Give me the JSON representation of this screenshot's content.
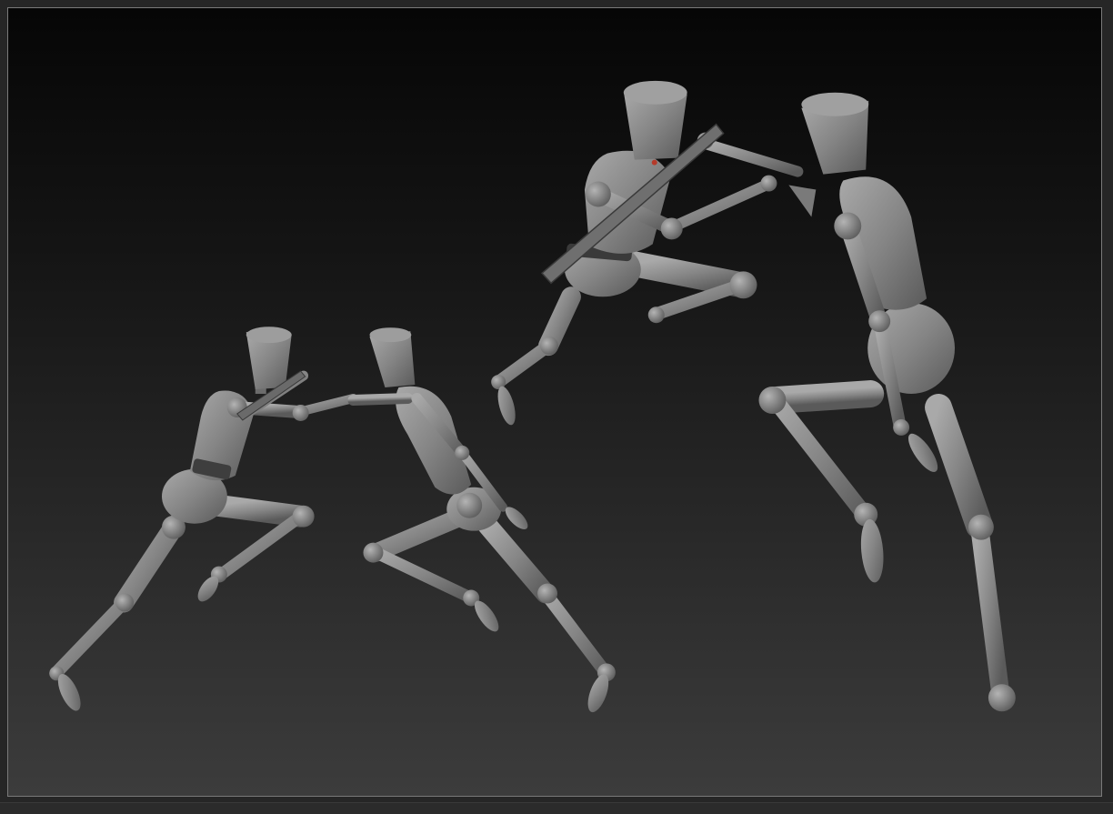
{
  "viewport": {
    "title": "",
    "background_top": "#060606",
    "background_bottom": "#3c3c3c",
    "border_color": "#7a7a7a"
  },
  "scene": {
    "model_color": "#8f8f8f",
    "model_shadow": "#4a4a4a",
    "figures": [
      {
        "name": "mannequin-figure-small-left",
        "prop": "sword"
      },
      {
        "name": "mannequin-figure-small-right",
        "prop": "none"
      },
      {
        "name": "mannequin-figure-large-left",
        "prop": "sword"
      },
      {
        "name": "mannequin-figure-large-right",
        "prop": "none"
      }
    ]
  }
}
